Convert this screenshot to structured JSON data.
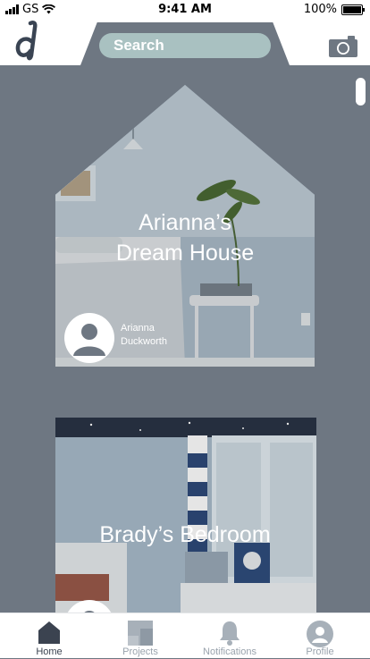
{
  "status_bar": {
    "carrier": "GS",
    "time": "9:41 AM",
    "battery": "100%",
    "battery_level": 1.0
  },
  "header": {
    "logo_text": "d",
    "search_placeholder": "Search",
    "camera_icon": "camera-icon"
  },
  "feed": {
    "cards": [
      {
        "title": "Arianna’s Dream House",
        "title_lines": [
          "Arianna’s",
          "Dream House"
        ],
        "owner_first": "Arianna",
        "owner_last": "Duckworth"
      },
      {
        "title": "Brady’s Bedroom"
      }
    ]
  },
  "tabbar": {
    "tabs": [
      {
        "label": "Home",
        "icon": "home-icon",
        "active": true
      },
      {
        "label": "Projects",
        "icon": "projects-icon",
        "active": false
      },
      {
        "label": "Notifications",
        "icon": "bell-icon",
        "active": false
      },
      {
        "label": "Profile",
        "icon": "profile-icon",
        "active": false
      }
    ]
  },
  "colors": {
    "background": "#6e7782",
    "search_pill": "#a9c1c1",
    "tab_active": "#3b4350",
    "tab_inactive": "#9aa3ad"
  }
}
